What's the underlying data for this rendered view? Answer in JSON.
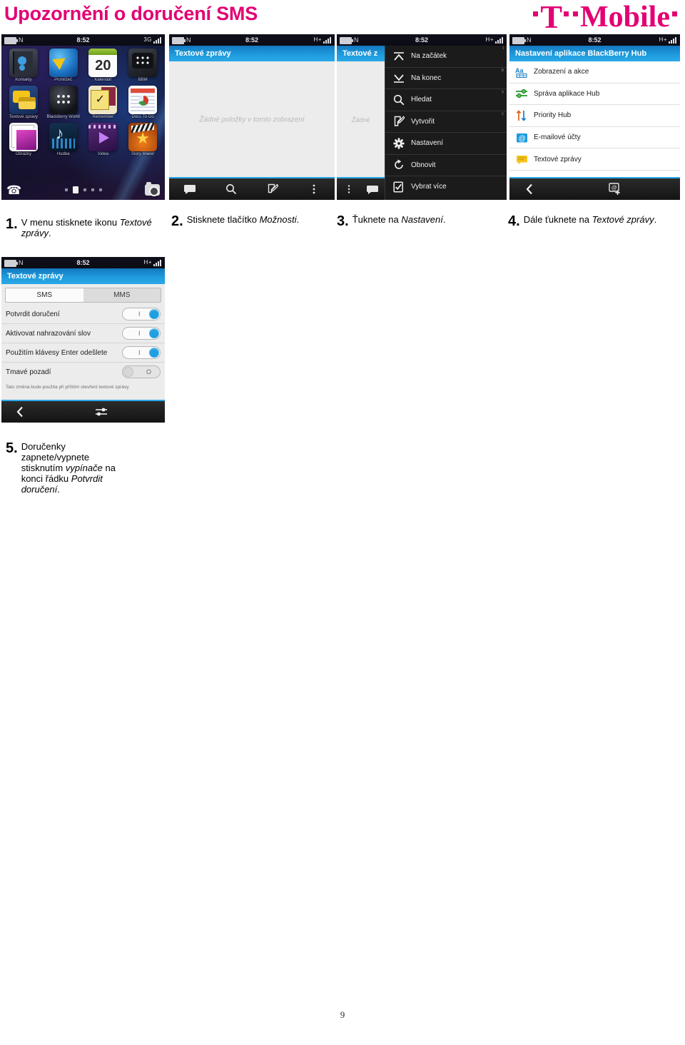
{
  "document": {
    "title": "Upozornění o doručení SMS",
    "brand": "T-Mobile",
    "brand_color": "#e20074",
    "page_number": "9"
  },
  "status_bar": {
    "network_letter": "N",
    "clock": "8:52",
    "signal_3g": "3G",
    "signal_hplus": "H+"
  },
  "screens": {
    "home": {
      "apps": [
        {
          "label": "Kontakty",
          "icon": "contacts-icon"
        },
        {
          "label": "Prohlížeč",
          "icon": "browser-icon"
        },
        {
          "label": "Kalendář",
          "icon": "calendar-icon",
          "day": "20"
        },
        {
          "label": "BBM",
          "icon": "bbm-icon"
        },
        {
          "label": "Textové zprávy",
          "icon": "text-messages-icon"
        },
        {
          "label": "BlackBerry World",
          "icon": "blackberry-world-icon"
        },
        {
          "label": "Remember",
          "icon": "remember-icon"
        },
        {
          "label": "Docs To Go",
          "icon": "docs-to-go-icon"
        },
        {
          "label": "Obrázky",
          "icon": "pictures-icon"
        },
        {
          "label": "Hudba",
          "icon": "music-icon"
        },
        {
          "label": "Videa",
          "icon": "video-icon"
        },
        {
          "label": "Story Maker",
          "icon": "story-maker-icon"
        }
      ],
      "dock": {
        "phone_icon": "phone-icon",
        "camera_icon": "camera-icon",
        "page_dots": 5,
        "active_dot": 2
      }
    },
    "messages_list": {
      "header": "Textové zprávy",
      "empty_text": "Žádné položky v tomto zobrazení",
      "toolbar": [
        {
          "icon": "messages-icon"
        },
        {
          "icon": "search-icon"
        },
        {
          "icon": "compose-icon"
        },
        {
          "icon": "overflow-menu-icon"
        }
      ]
    },
    "options_menu": {
      "header": "Textové z",
      "empty_text": "Žádné",
      "items": [
        {
          "label": "Na začátek",
          "icon": "arrow-to-top-icon",
          "shortcut": "t"
        },
        {
          "label": "Na konec",
          "icon": "arrow-to-bottom-icon",
          "shortcut": "b"
        },
        {
          "label": "Hledat",
          "icon": "search-icon",
          "shortcut": "s"
        },
        {
          "label": "Vytvořit",
          "icon": "compose-icon",
          "shortcut": "c"
        },
        {
          "label": "Nastavení",
          "icon": "gear-icon",
          "shortcut": ""
        },
        {
          "label": "Obnovit",
          "icon": "refresh-icon",
          "shortcut": ""
        },
        {
          "label": "Vybrat více",
          "icon": "select-more-icon",
          "shortcut": ""
        }
      ]
    },
    "hub_settings": {
      "header": "Nastavení aplikace BlackBerry Hub",
      "items": [
        {
          "label": "Zobrazení a akce",
          "icon": "display-actions-icon"
        },
        {
          "label": "Správa aplikace Hub",
          "icon": "hub-management-icon"
        },
        {
          "label": "Priority Hub",
          "icon": "priority-hub-icon"
        },
        {
          "label": "E-mailové účty",
          "icon": "email-accounts-icon"
        },
        {
          "label": "Textové zprávy",
          "icon": "text-messages-icon"
        }
      ],
      "toolbar": [
        {
          "icon": "back-icon"
        },
        {
          "icon": "add-account-icon"
        }
      ]
    },
    "sms_settings": {
      "header": "Textové zprávy",
      "tabs": [
        {
          "label": "SMS",
          "selected": true
        },
        {
          "label": "MMS",
          "selected": false
        }
      ],
      "rows": [
        {
          "label": "Potvrdit doručení",
          "state": "on",
          "on_mark": "I"
        },
        {
          "label": "Aktivovat nahrazování slov",
          "state": "on",
          "on_mark": "I"
        },
        {
          "label": "Použitím klávesy Enter odešlete",
          "state": "on",
          "on_mark": "I"
        },
        {
          "label": "Tmavé pozadí",
          "state": "off",
          "off_mark": "O"
        }
      ],
      "note": "Tato změna bude použita při příštím otevření textové zprávy.",
      "toolbar": [
        {
          "icon": "back-icon"
        },
        {
          "icon": "settings-sliders-icon"
        }
      ]
    }
  },
  "steps": [
    {
      "number": "1.",
      "text_before": "V menu stisknete ikonu ",
      "text_italic": "Textové zprávy",
      "text_after": "."
    },
    {
      "number": "2.",
      "text_before": "Stisknete tlačítko ",
      "text_italic": "Možnosti",
      "text_after": "."
    },
    {
      "number": "3.",
      "text_before": "Ťuknete na ",
      "text_italic": "Nastavení",
      "text_after": "."
    },
    {
      "number": "4.",
      "text_before": "Dále ťuknete na ",
      "text_italic": "Textové zprávy",
      "text_after": "."
    },
    {
      "number": "5.",
      "text_before": "Doručenky zapnete/vypnete stisknutím ",
      "text_italic": "vypínače",
      "text_after": " na konci řádku ",
      "text_italic2": "Potvrdit doručení",
      "text_after2": "."
    }
  ]
}
